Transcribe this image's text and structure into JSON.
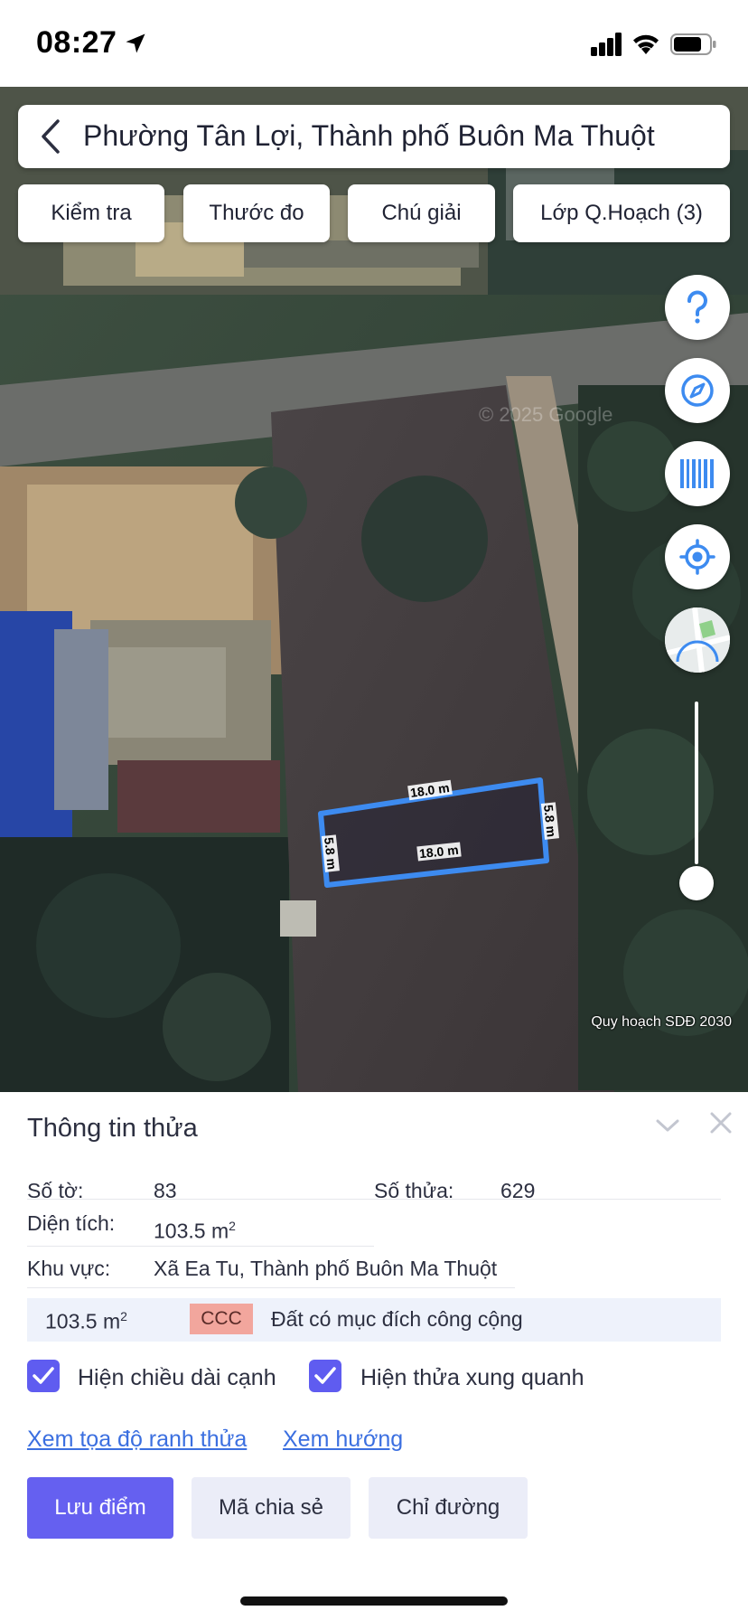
{
  "status_bar": {
    "time": "08:27"
  },
  "header": {
    "title": "Phường Tân Lợi, Thành phố Buôn Ma Thuột",
    "chips": [
      "Kiểm tra",
      "Thước đo",
      "Chú giải",
      "Lớp Q.Hoạch (3)"
    ]
  },
  "map": {
    "watermark": "© 2025 Google",
    "attribution": "Quy hoạch SDĐ 2030",
    "parcel_edges": [
      "18.0 m",
      "5.8 m",
      "18.0 m",
      "5.8 m"
    ],
    "zoom_level": 0.05,
    "parcel_color": "#3d8bf0",
    "fab_icons": [
      "help-icon",
      "compass-icon",
      "barcode-icon",
      "locate-icon",
      "map-style-icon"
    ]
  },
  "info": {
    "title": "Thông tin thửa",
    "sheet_label": "Số tờ:",
    "sheet_value": "83",
    "parcel_label": "Số thửa:",
    "parcel_value": "629",
    "area_label": "Diện tích:",
    "area_value": "103.5 m",
    "area_unit_sup": "2",
    "region_label": "Khu vực:",
    "region_value": "Xã Ea Tu, Thành phố Buôn Ma Thuột",
    "zone": {
      "area": "103.5 m",
      "area_unit_sup": "2",
      "code": "CCC",
      "description": "Đất có mục đích công cộng",
      "code_color": "#f2a69d"
    }
  },
  "options": {
    "show_edge_length": {
      "label": "Hiện chiều dài cạnh",
      "checked": true
    },
    "show_neighbors": {
      "label": "Hiện thửa xung quanh",
      "checked": true
    }
  },
  "links": {
    "coordinates": "Xem tọa độ ranh thửa",
    "direction": "Xem hướng"
  },
  "actions": {
    "save": "Lưu điểm",
    "share": "Mã chia sẻ",
    "route": "Chỉ đường"
  },
  "colors": {
    "accent": "#6560f0",
    "link": "#3b6fe0"
  }
}
